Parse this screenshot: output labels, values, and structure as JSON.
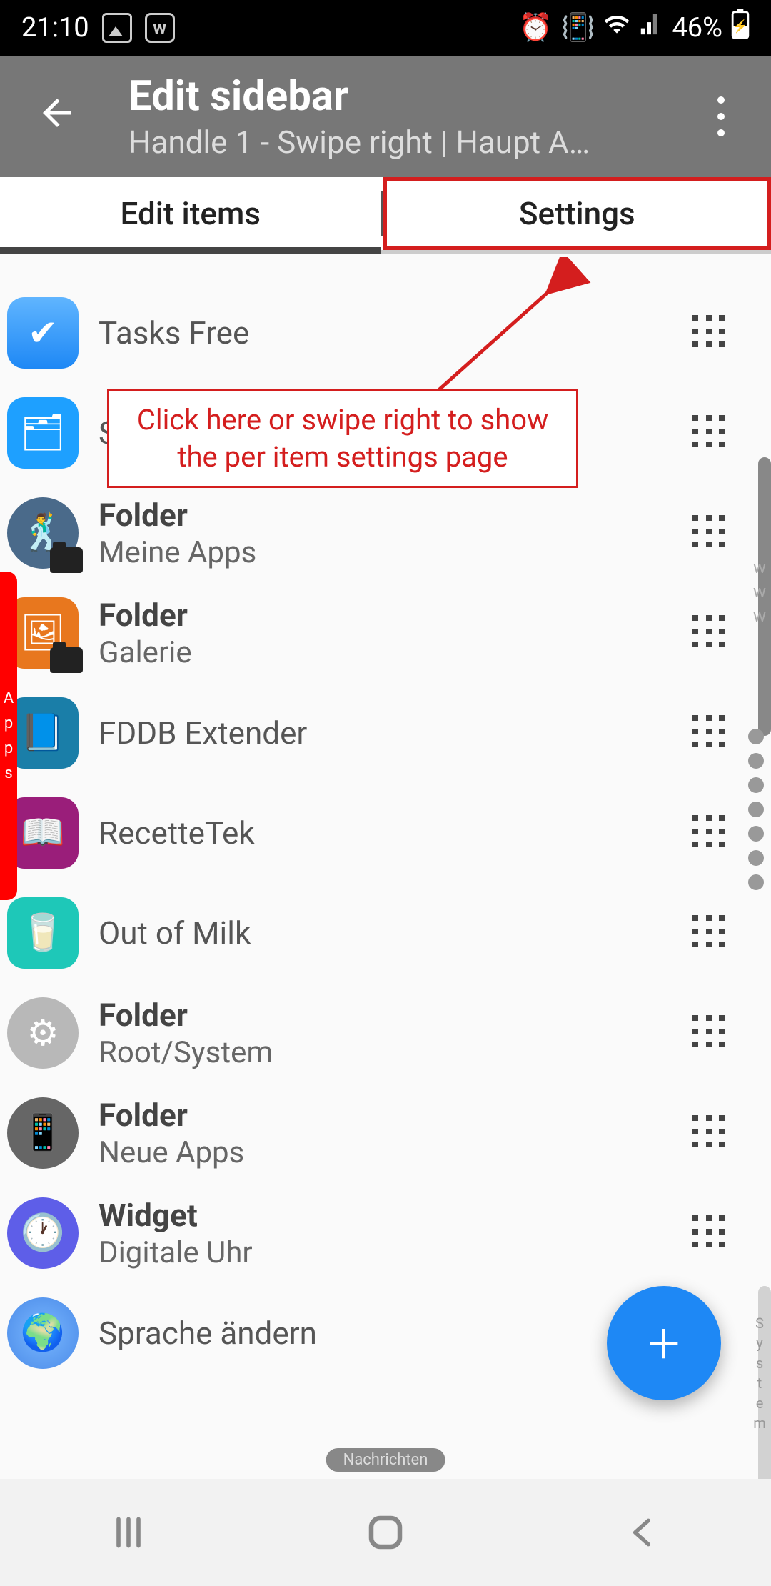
{
  "status": {
    "time": "21:10",
    "battery": "46%"
  },
  "toolbar": {
    "title": "Edit sidebar",
    "subtitle": "Handle 1 - Swipe right | Haupt A…"
  },
  "tabs": {
    "edit_items": "Edit items",
    "settings": "Settings"
  },
  "callout": "Click here or swipe right to show the per item settings page",
  "items": [
    {
      "title": "Tasks Free",
      "subtitle": "",
      "type": "app"
    },
    {
      "title": "S",
      "subtitle": "",
      "type": "app"
    },
    {
      "title": "Folder",
      "subtitle": "Meine Apps",
      "type": "folder"
    },
    {
      "title": "Folder",
      "subtitle": "Galerie",
      "type": "folder"
    },
    {
      "title": "FDDB Extender",
      "subtitle": "",
      "type": "app"
    },
    {
      "title": "RecetteTek",
      "subtitle": "",
      "type": "app"
    },
    {
      "title": "Out of Milk",
      "subtitle": "",
      "type": "app"
    },
    {
      "title": "Folder",
      "subtitle": "Root/System",
      "type": "folder"
    },
    {
      "title": "Folder",
      "subtitle": "Neue Apps",
      "type": "folder"
    },
    {
      "title": "Widget",
      "subtitle": "Digitale Uhr",
      "type": "widget"
    },
    {
      "title": "Sprache ändern",
      "subtitle": "",
      "type": "app"
    }
  ],
  "handle_left": "Apps",
  "pill": "Nachrichten",
  "www": "www",
  "system_label": "System"
}
